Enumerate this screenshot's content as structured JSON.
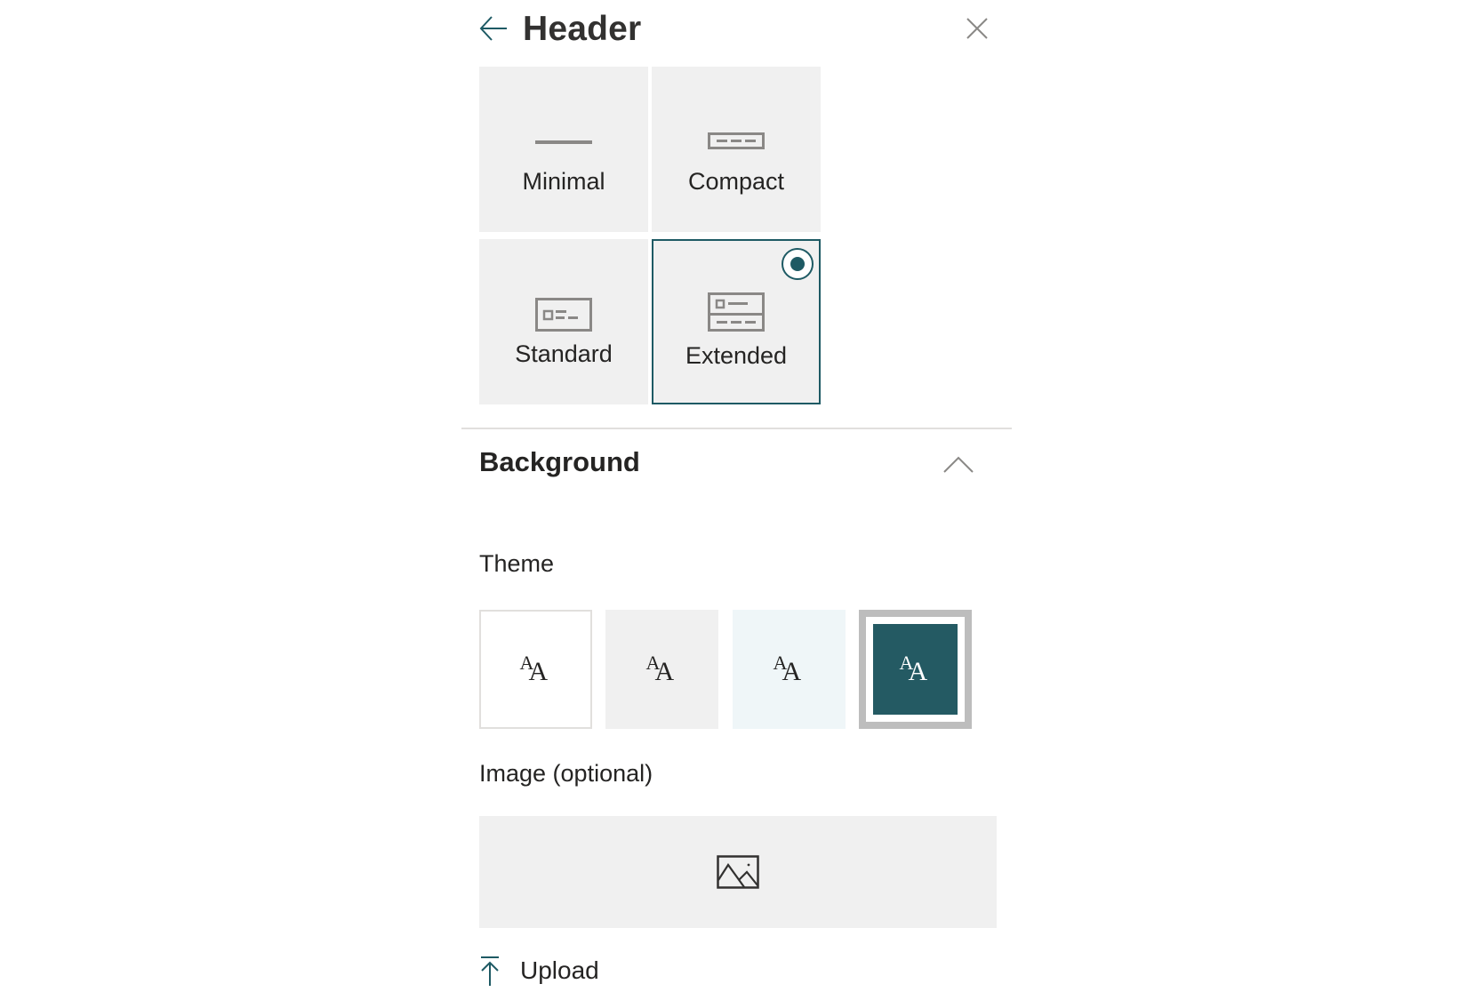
{
  "panel": {
    "title": "Header",
    "back_icon": "arrow-left-icon",
    "close_icon": "close-icon"
  },
  "layout": {
    "selected": "Extended",
    "options": [
      {
        "label": "Minimal",
        "icon": "layout-minimal-icon"
      },
      {
        "label": "Compact",
        "icon": "layout-compact-icon"
      },
      {
        "label": "Standard",
        "icon": "layout-standard-icon"
      },
      {
        "label": "Extended",
        "icon": "layout-extended-icon"
      }
    ]
  },
  "background": {
    "title": "Background",
    "collapse_icon": "chevron-up-icon",
    "theme_label": "Theme",
    "themes": [
      {
        "name": "white",
        "glyph": "A",
        "bg": "#ffffff",
        "fg": "#252423"
      },
      {
        "name": "neutral",
        "glyph": "A",
        "bg": "#f0f0f0",
        "fg": "#252423"
      },
      {
        "name": "soft",
        "glyph": "A",
        "bg": "#eff6f8",
        "fg": "#252423"
      },
      {
        "name": "strong",
        "glyph": "A",
        "bg": "#245a63",
        "fg": "#ffffff"
      }
    ],
    "selected_theme": "strong",
    "image_label": "Image (optional)",
    "image_placeholder_icon": "image-icon",
    "upload_label": "Upload",
    "upload_icon": "upload-icon"
  },
  "colors": {
    "accent": "#1e5a64",
    "tile_bg": "#f0f0f0",
    "icon_gray": "#8a8886"
  }
}
